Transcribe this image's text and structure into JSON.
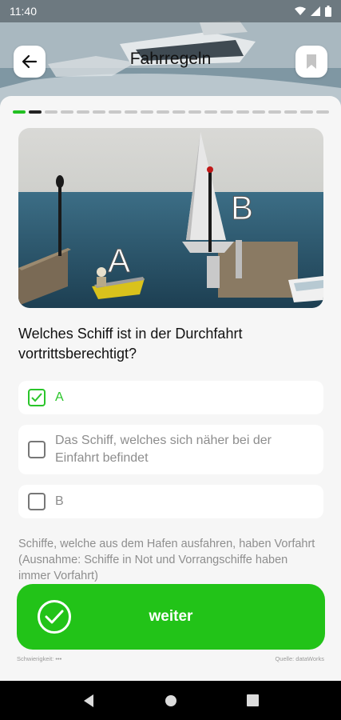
{
  "status_bar": {
    "time": "11:40"
  },
  "header": {
    "title": "Fahrregeln"
  },
  "progress": {
    "total": 20,
    "done": 1,
    "current_index": 1
  },
  "scene": {
    "label_a": "A",
    "label_b": "B"
  },
  "question": {
    "text": "Welches Schiff ist in der Durchfahrt vortrittsberechtigt?"
  },
  "options": [
    {
      "label": "A",
      "checked": true,
      "correct": true
    },
    {
      "label": "Das Schiff, welches sich näher bei der Einfahrt befindet",
      "checked": false,
      "correct": false
    },
    {
      "label": "B",
      "checked": false,
      "correct": false
    }
  ],
  "explanation": "Schiffe, welche aus dem Hafen ausfahren, haben Vorfahrt (Ausnahme: Schiffe in Not und Vorrangschiffe haben immer Vorfahrt)",
  "next_button": {
    "label": "weiter"
  },
  "footer": {
    "difficulty": "Schwierigkeit: •••",
    "source": "Quelle: dataWorks"
  },
  "colors": {
    "accent": "#22c318",
    "correct": "#2ac52a",
    "muted": "#8e8e8e"
  }
}
